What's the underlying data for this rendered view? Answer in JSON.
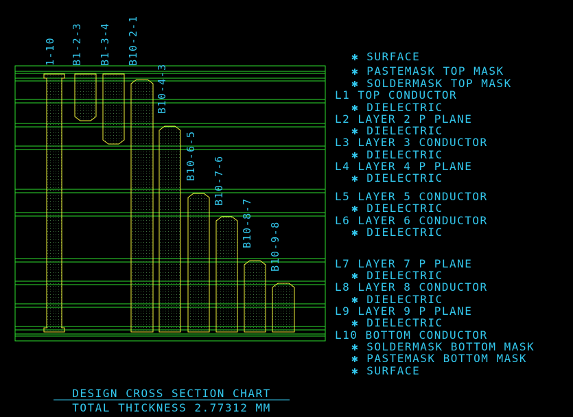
{
  "colors": {
    "background": "#000000",
    "layer_line": "#2ee02e",
    "via_outline": "#f2f23a",
    "via_fill_dot": "#3c6e3c",
    "label": "#33c8ee",
    "title": "#33c8ee"
  },
  "vias": [
    {
      "label": "1-10"
    },
    {
      "label": "B1-2-3"
    },
    {
      "label": "B1-3-4"
    },
    {
      "label": "B10-2-1"
    },
    {
      "label": "B10-4-3"
    },
    {
      "label": "B10-6-5"
    },
    {
      "label": "B10-7-6"
    },
    {
      "label": "B10-8-7"
    },
    {
      "label": "B10-9-8"
    }
  ],
  "stackup": [
    {
      "text": "✱  SURFACE"
    },
    {
      "text": "✱ PASTEMASK TOP MASK"
    },
    {
      "text": "✱ SOLDERMASK TOP MASK"
    },
    {
      "text": "L1 TOP CONDUCTOR"
    },
    {
      "text": "✱  DIELECTRIC"
    },
    {
      "text": "L2 LAYER 2 P PLANE"
    },
    {
      "text": "✱  DIELECTRIC"
    },
    {
      "text": "L3 LAYER 3 CONDUCTOR"
    },
    {
      "text": "✱  DIELECTRIC"
    },
    {
      "text": "L4 LAYER 4 P PLANE"
    },
    {
      "text": "✱  DIELECTRIC"
    },
    {
      "text": "L5 LAYER 5 CONDUCTOR"
    },
    {
      "text": "✱  DIELECTRIC"
    },
    {
      "text": "L6 LAYER 6 CONDUCTOR"
    },
    {
      "text": "✱  DIELECTRIC"
    },
    {
      "text": "L7 LAYER 7 P PLANE"
    },
    {
      "text": "✱  DIELECTRIC"
    },
    {
      "text": "L8 LAYER 8 CONDUCTOR"
    },
    {
      "text": "✱  DIELECTRIC"
    },
    {
      "text": "L9 LAYER 9 P PLANE"
    },
    {
      "text": "✱  DIELECTRIC"
    },
    {
      "text": "L10 BOTTOM CONDUCTOR"
    },
    {
      "text": "✱ SOLDERMASK BOTTOM MASK"
    },
    {
      "text": "✱ PASTEMASK BOTTOM MASK"
    },
    {
      "text": "✱  SURFACE"
    }
  ],
  "title": {
    "line1": "DESIGN CROSS SECTION CHART",
    "line2": "TOTAL THICKNESS 2.77312 MM"
  }
}
